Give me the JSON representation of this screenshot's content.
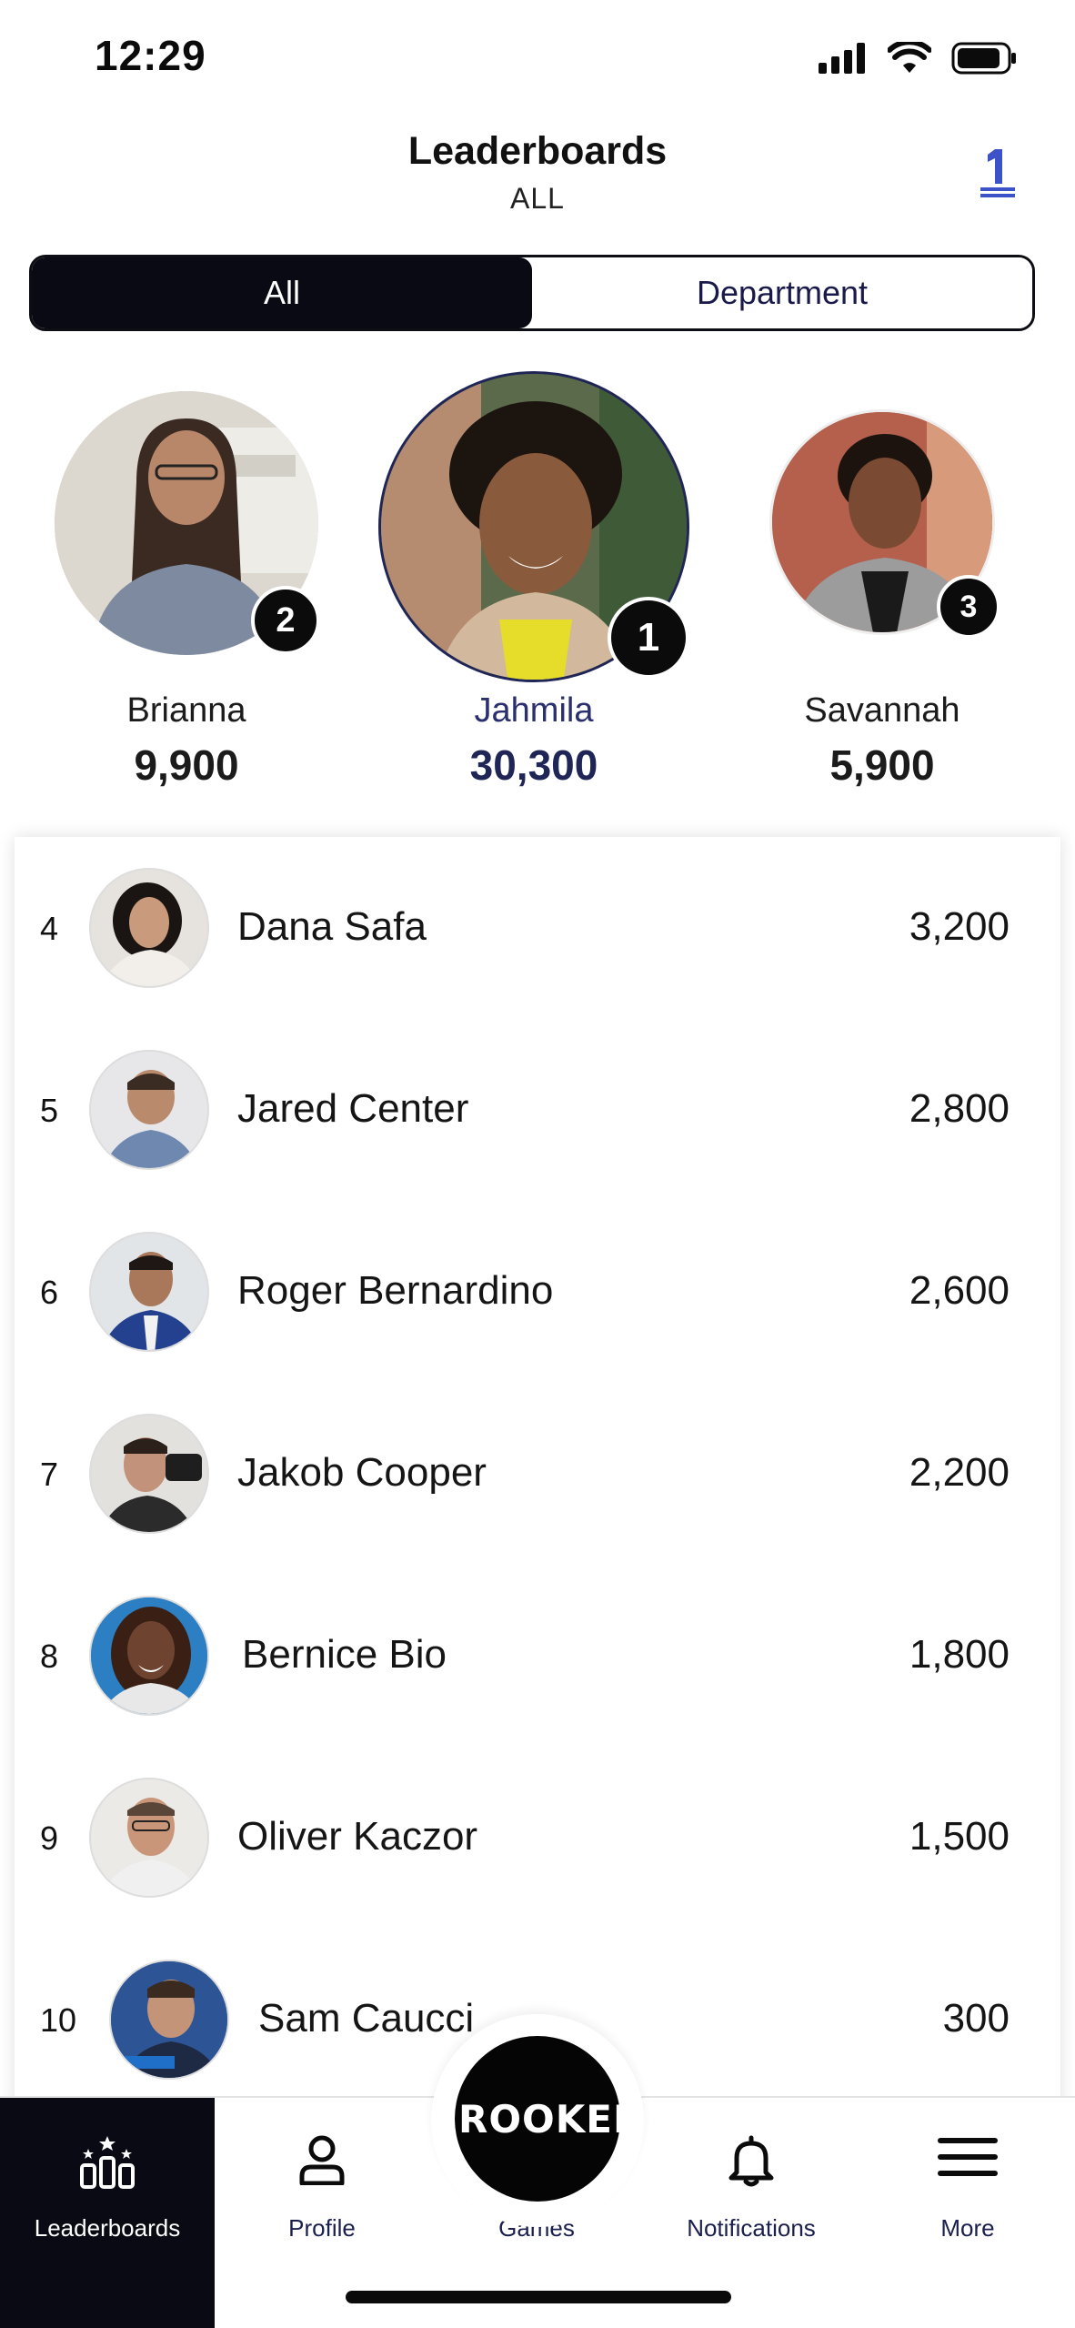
{
  "status_bar": {
    "time": "12:29"
  },
  "header": {
    "title": "Leaderboards",
    "subtitle": "ALL"
  },
  "segments": {
    "all": "All",
    "department": "Department"
  },
  "podium": [
    {
      "place": "2",
      "name": "Brianna",
      "score": "9,900"
    },
    {
      "place": "1",
      "name": "Jahmila",
      "score": "30,300"
    },
    {
      "place": "3",
      "name": "Savannah",
      "score": "5,900"
    }
  ],
  "leaders": [
    {
      "rank": "4",
      "name": "Dana Safa",
      "score": "3,200"
    },
    {
      "rank": "5",
      "name": "Jared Center",
      "score": "2,800"
    },
    {
      "rank": "6",
      "name": "Roger Bernardino",
      "score": "2,600"
    },
    {
      "rank": "7",
      "name": "Jakob Cooper",
      "score": "2,200"
    },
    {
      "rank": "8",
      "name": "Bernice Bio",
      "score": "1,800"
    },
    {
      "rank": "9",
      "name": "Oliver Kaczor",
      "score": "1,500"
    },
    {
      "rank": "10",
      "name": "Sam Caucci",
      "score": "300"
    }
  ],
  "tabs": {
    "leaderboards": "Leaderboards",
    "profile": "Profile",
    "games": "Games",
    "games_logo": "CROOKED",
    "notifications": "Notifications",
    "more": "More"
  },
  "colors": {
    "active_tab_bg": "#0a0a14",
    "first_place_text": "#2a2f6e",
    "rank_icon": "#3b52c8"
  }
}
